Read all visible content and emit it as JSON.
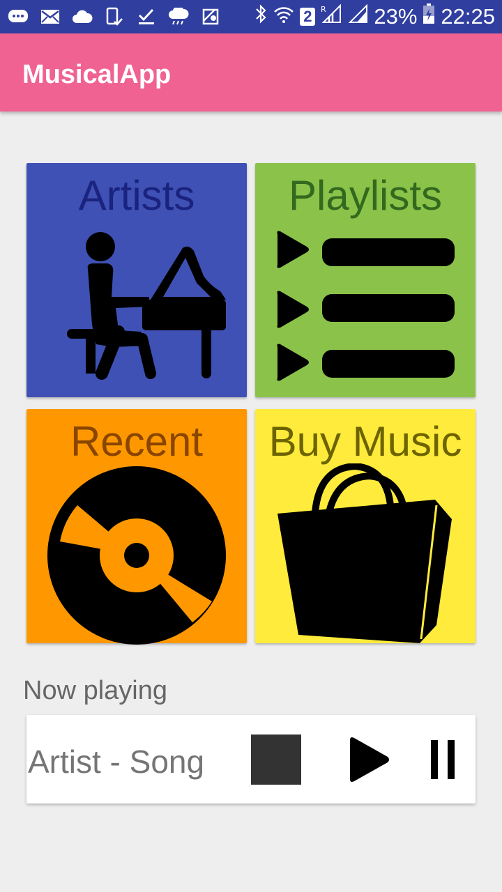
{
  "status_bar": {
    "battery": "23%",
    "time": "22:25",
    "sim_number": "2",
    "icons": [
      "chat-icon",
      "mail-icon",
      "cloud-icon",
      "phone-check-icon",
      "download-check-icon",
      "cloud-rain-icon",
      "map-icon",
      "bluetooth-icon",
      "wifi-icon",
      "sim-icon",
      "signal-roaming-icon",
      "signal-icon",
      "battery-charging-icon"
    ]
  },
  "app_bar": {
    "title": "MusicalApp"
  },
  "tiles": [
    {
      "label": "Artists",
      "color": "#3f51b5",
      "icon": "piano-player-icon"
    },
    {
      "label": "Playlists",
      "color": "#8bc34a",
      "icon": "playlist-icon"
    },
    {
      "label": "Recent",
      "color": "#ff9800",
      "icon": "vinyl-disc-icon"
    },
    {
      "label": "Buy Music",
      "color": "#ffeb3b",
      "icon": "shopping-bag-icon"
    }
  ],
  "now_playing": {
    "label": "Now playing",
    "song": "Artist - Song",
    "controls": [
      "stop-icon",
      "play-icon",
      "pause-icon"
    ]
  },
  "colors": {
    "status_bar": "#303f9f",
    "app_bar": "#f06292",
    "background": "#eeeeee"
  }
}
